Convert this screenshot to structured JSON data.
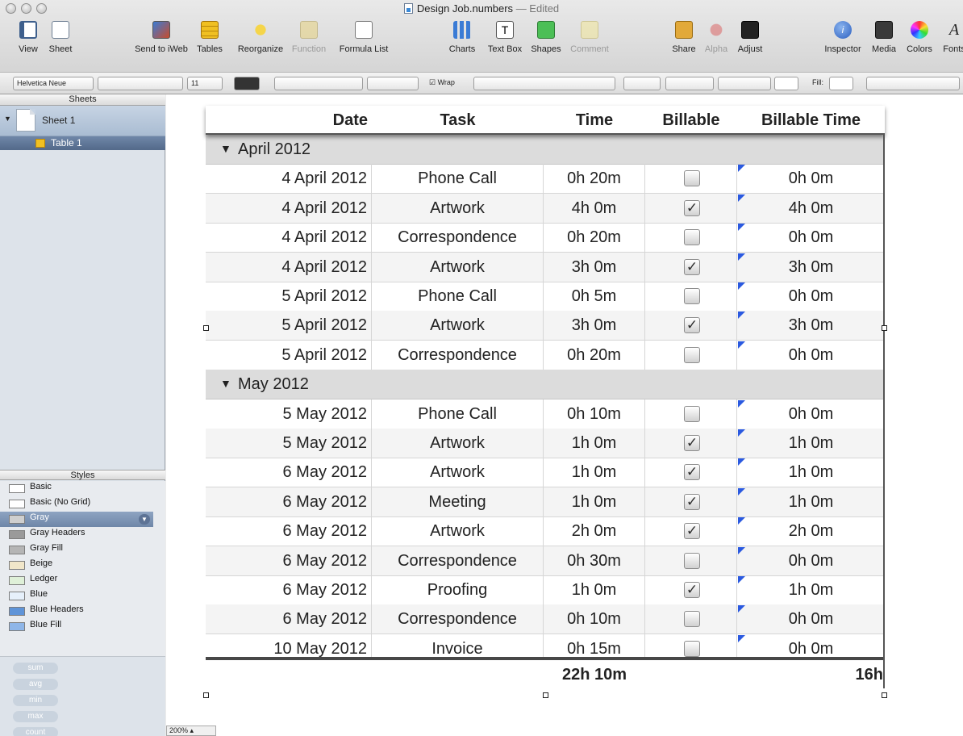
{
  "window": {
    "title": "Design Job.numbers",
    "edited": "— Edited"
  },
  "toolbar": {
    "view": "View",
    "sheet": "Sheet",
    "send_to_iweb": "Send to iWeb",
    "tables": "Tables",
    "reorganize": "Reorganize",
    "function": "Function",
    "formula_list": "Formula List",
    "charts": "Charts",
    "text_box": "Text Box",
    "shapes": "Shapes",
    "comment": "Comment",
    "share": "Share",
    "alpha": "Alpha",
    "adjust": "Adjust",
    "inspector": "Inspector",
    "media": "Media",
    "colors": "Colors",
    "fonts": "Fonts"
  },
  "format_bar": {
    "font": "Helvetica Neue",
    "size": "11",
    "wrap": "Wrap",
    "fill": "Fill:"
  },
  "sidebar": {
    "sheets_header": "Sheets",
    "sheet_name": "Sheet 1",
    "table_name": "Table 1",
    "styles_header": "Styles",
    "styles": [
      {
        "name": "Basic",
        "selected": false,
        "swatch": "#ffffff"
      },
      {
        "name": "Basic (No Grid)",
        "selected": false,
        "swatch": "#ffffff"
      },
      {
        "name": "Gray",
        "selected": true,
        "swatch": "#cfcfcf"
      },
      {
        "name": "Gray Headers",
        "selected": false,
        "swatch": "#9a9a9a"
      },
      {
        "name": "Gray Fill",
        "selected": false,
        "swatch": "#b5b5b5"
      },
      {
        "name": "Beige",
        "selected": false,
        "swatch": "#f1e6c9"
      },
      {
        "name": "Ledger",
        "selected": false,
        "swatch": "#dff0d8"
      },
      {
        "name": "Blue",
        "selected": false,
        "swatch": "#e6f0fb"
      },
      {
        "name": "Blue Headers",
        "selected": false,
        "swatch": "#5f94d8"
      },
      {
        "name": "Blue Fill",
        "selected": false,
        "swatch": "#8fb6e8"
      }
    ],
    "quick_calc": [
      "sum",
      "avg",
      "min",
      "max",
      "count"
    ]
  },
  "zoom": "200%",
  "table": {
    "headers": [
      "Date",
      "Task",
      "Time",
      "Billable",
      "Billable Time"
    ],
    "groups": [
      {
        "label": "April 2012",
        "rows": [
          {
            "date": "4 April 2012",
            "task": "Phone Call",
            "time": "0h 20m",
            "billable": false,
            "billable_time": "0h 0m"
          },
          {
            "date": "4 April 2012",
            "task": "Artwork",
            "time": "4h 0m",
            "billable": true,
            "billable_time": "4h 0m"
          },
          {
            "date": "4 April 2012",
            "task": "Correspondence",
            "time": "0h 20m",
            "billable": false,
            "billable_time": "0h 0m"
          },
          {
            "date": "4 April 2012",
            "task": "Artwork",
            "time": "3h 0m",
            "billable": true,
            "billable_time": "3h 0m"
          },
          {
            "date": "5 April 2012",
            "task": "Phone Call",
            "time": "0h 5m",
            "billable": false,
            "billable_time": "0h 0m"
          },
          {
            "date": "5 April 2012",
            "task": "Artwork",
            "time": "3h 0m",
            "billable": true,
            "billable_time": "3h 0m"
          },
          {
            "date": "5 April 2012",
            "task": "Correspondence",
            "time": "0h 20m",
            "billable": false,
            "billable_time": "0h 0m"
          }
        ]
      },
      {
        "label": "May 2012",
        "rows": [
          {
            "date": "5 May 2012",
            "task": "Phone Call",
            "time": "0h 10m",
            "billable": false,
            "billable_time": "0h 0m"
          },
          {
            "date": "5 May 2012",
            "task": "Artwork",
            "time": "1h 0m",
            "billable": true,
            "billable_time": "1h 0m"
          },
          {
            "date": "6 May 2012",
            "task": "Artwork",
            "time": "1h 0m",
            "billable": true,
            "billable_time": "1h 0m"
          },
          {
            "date": "6 May 2012",
            "task": "Meeting",
            "time": "1h 0m",
            "billable": true,
            "billable_time": "1h 0m"
          },
          {
            "date": "6 May 2012",
            "task": "Artwork",
            "time": "2h 0m",
            "billable": true,
            "billable_time": "2h 0m"
          },
          {
            "date": "6 May 2012",
            "task": "Correspondence",
            "time": "0h 30m",
            "billable": false,
            "billable_time": "0h 0m"
          },
          {
            "date": "6 May 2012",
            "task": "Proofing",
            "time": "1h 0m",
            "billable": true,
            "billable_time": "1h 0m"
          },
          {
            "date": "6 May 2012",
            "task": "Correspondence",
            "time": "0h 10m",
            "billable": false,
            "billable_time": "0h 0m"
          },
          {
            "date": "10 May 2012",
            "task": "Invoice",
            "time": "0h 15m",
            "billable": false,
            "billable_time": "0h 0m"
          }
        ]
      }
    ],
    "footer": {
      "time_total": "22h 10m",
      "billable_total": "16h"
    }
  }
}
